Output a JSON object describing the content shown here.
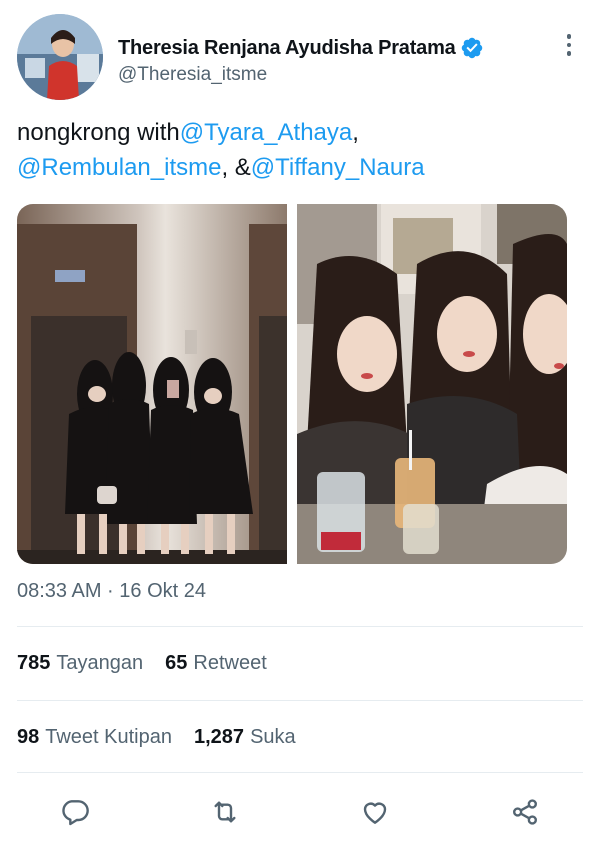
{
  "author": {
    "display_name": "Theresia Renjana Ayudisha Pratama",
    "handle": "@Theresia_itsme",
    "verified": true
  },
  "tweet": {
    "text_prefix": "nongkrong with",
    "mention_1": "@Tyara_Athaya",
    "sep_1": ",",
    "mention_2": "@Rembulan_itsme",
    "sep_2": ", &",
    "mention_3": "@Tiffany_Naura"
  },
  "timestamp": "08:33 AM · 16 Okt 24",
  "stats": {
    "views_count": "785",
    "views_label": "Tayangan",
    "retweets_count": "65",
    "retweets_label": "Retweet",
    "quotes_count": "98",
    "quotes_label": "Tweet Kutipan",
    "likes_count": "1,287",
    "likes_label": "Suka"
  },
  "actions": [
    "reply-icon",
    "retweet-icon",
    "like-icon",
    "share-icon"
  ],
  "colors": {
    "accent": "#1d9bf0",
    "text": "#0f1419",
    "secondary": "#536471",
    "divider": "#e6ecf0"
  }
}
